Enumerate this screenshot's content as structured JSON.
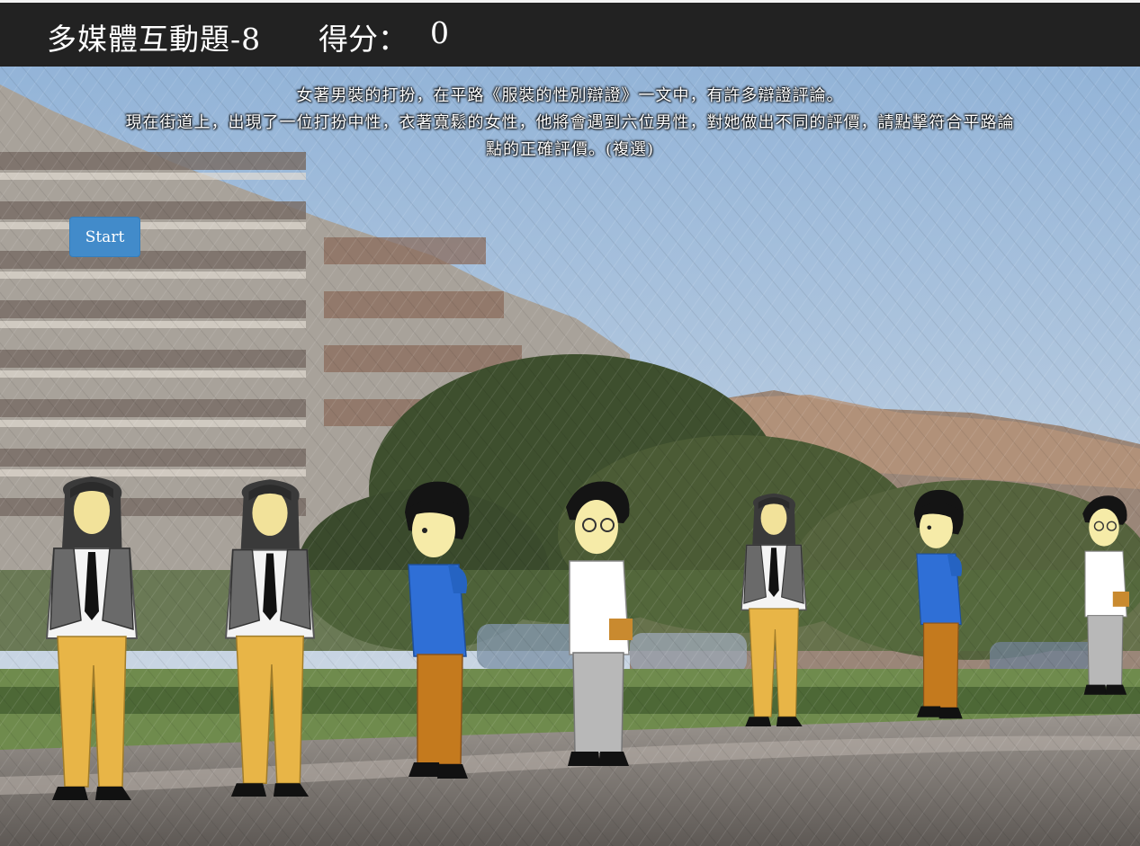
{
  "header": {
    "title": "多媒體互動題-8",
    "score_label": "得分：",
    "score_value": "0"
  },
  "instructions": {
    "line1": "女著男裝的打扮，在平路《服裝的性別辯證》一文中，有許多辯證評論。",
    "line2": "現在街道上，出現了一位打扮中性，衣著寬鬆的女性，他將會遇到六位男性，對她做出不同的評價，請點擊符合平路論",
    "line3": "點的正確評價。(複選)"
  },
  "controls": {
    "start_label": "Start"
  },
  "colors": {
    "header_bg": "#222222",
    "start_button": "#428bca",
    "sky": "#a9c2db",
    "hoodie_blue": "#2f6fd6",
    "pants_brown": "#c47a1e",
    "pants_yellow": "#e8b547",
    "pants_gray": "#b8b8b8"
  },
  "characters": [
    {
      "id": "woman-1",
      "type": "androgynous-woman"
    },
    {
      "id": "woman-2",
      "type": "androgynous-woman"
    },
    {
      "id": "man-hoodie-1",
      "type": "man-blue-hoodie"
    },
    {
      "id": "man-glasses-1",
      "type": "man-glasses"
    },
    {
      "id": "woman-3",
      "type": "androgynous-woman"
    },
    {
      "id": "man-hoodie-2",
      "type": "man-blue-hoodie"
    },
    {
      "id": "man-glasses-2",
      "type": "man-glasses"
    }
  ]
}
